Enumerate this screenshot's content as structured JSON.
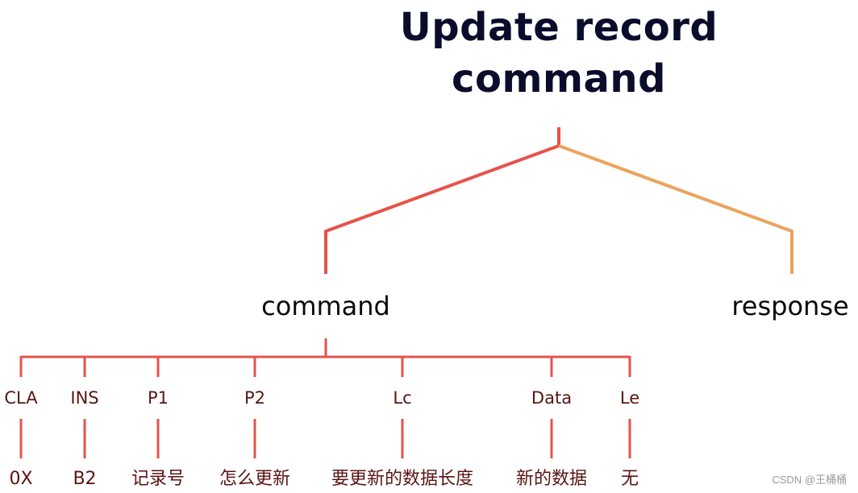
{
  "title": "Update record command",
  "title_lines": [
    "Update record",
    "command"
  ],
  "colors": {
    "command_branch": "#e5534b",
    "response_branch": "#eba45c",
    "title_text": "#0b0c2c",
    "leaf_text": "#5a1414"
  },
  "branches": {
    "command": "command",
    "response": "response"
  },
  "fields": [
    {
      "label": "CLA",
      "value": "0X"
    },
    {
      "label": "INS",
      "value": "B2"
    },
    {
      "label": "P1",
      "value": "记录号"
    },
    {
      "label": "P2",
      "value": "怎么更新"
    },
    {
      "label": "Lc",
      "value": "要更新的数据长度"
    },
    {
      "label": "Data",
      "value": "新的数据"
    },
    {
      "label": "Le",
      "value": "无"
    }
  ],
  "watermark": "CSDN @王桶桶"
}
